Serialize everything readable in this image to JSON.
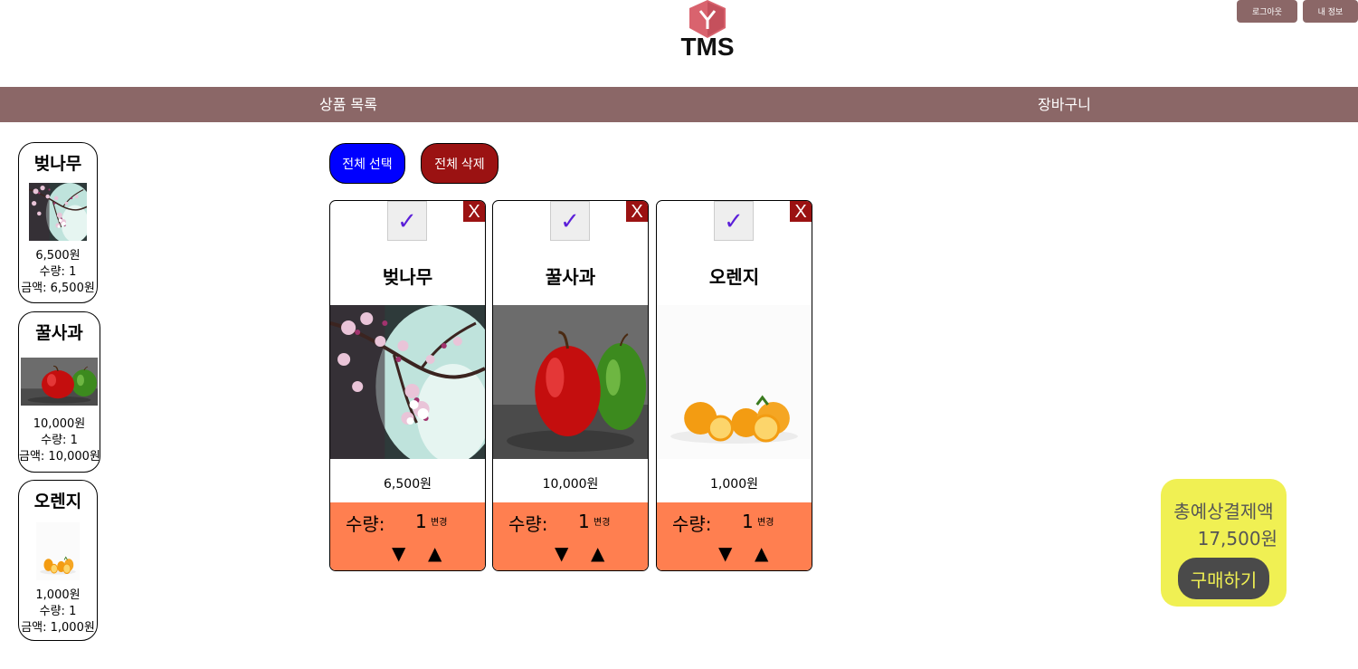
{
  "header": {
    "logo_text": "TMS",
    "logout_label": "로그아웃",
    "myinfo_label": "내 정보"
  },
  "nav": {
    "products_label": "상품 목록",
    "cart_label": "장바구니"
  },
  "sidebar": {
    "items": [
      {
        "name": "벚나무",
        "price": "6,500원",
        "quantity": "수량: 1",
        "amount": "금액: 6,500원",
        "image": "cherry-blossom"
      },
      {
        "name": "꿀사과",
        "price": "10,000원",
        "quantity": "수량: 1",
        "amount": "금액: 10,000원",
        "image": "apples"
      },
      {
        "name": "오렌지",
        "price": "1,000원",
        "quantity": "수량: 1",
        "amount": "금액: 1,000원",
        "image": "oranges"
      }
    ]
  },
  "actions": {
    "select_all_label": "전체 선택",
    "delete_all_label": "전체 삭제"
  },
  "cart": {
    "check_symbol": "✓",
    "delete_symbol": "X",
    "quantity_label": "수량:",
    "change_label": "변경",
    "down_symbol": "▼",
    "up_symbol": "▲",
    "items": [
      {
        "name": "벚나무",
        "price": "6,500원",
        "quantity": "1",
        "image": "cherry-blossom"
      },
      {
        "name": "꿀사과",
        "price": "10,000원",
        "quantity": "1",
        "image": "apples"
      },
      {
        "name": "오렌지",
        "price": "1,000원",
        "quantity": "1",
        "image": "oranges"
      }
    ]
  },
  "summary": {
    "label": "총예상결제액",
    "total": "17,500원",
    "buy_label": "구매하기"
  },
  "colors": {
    "brand": "#8b6767",
    "select_button": "#0000ff",
    "delete_button": "#9b1212",
    "quantity_bar": "#ff7f50",
    "summary_bg": "#f0f053",
    "buy_button": "#4a4a4a"
  }
}
